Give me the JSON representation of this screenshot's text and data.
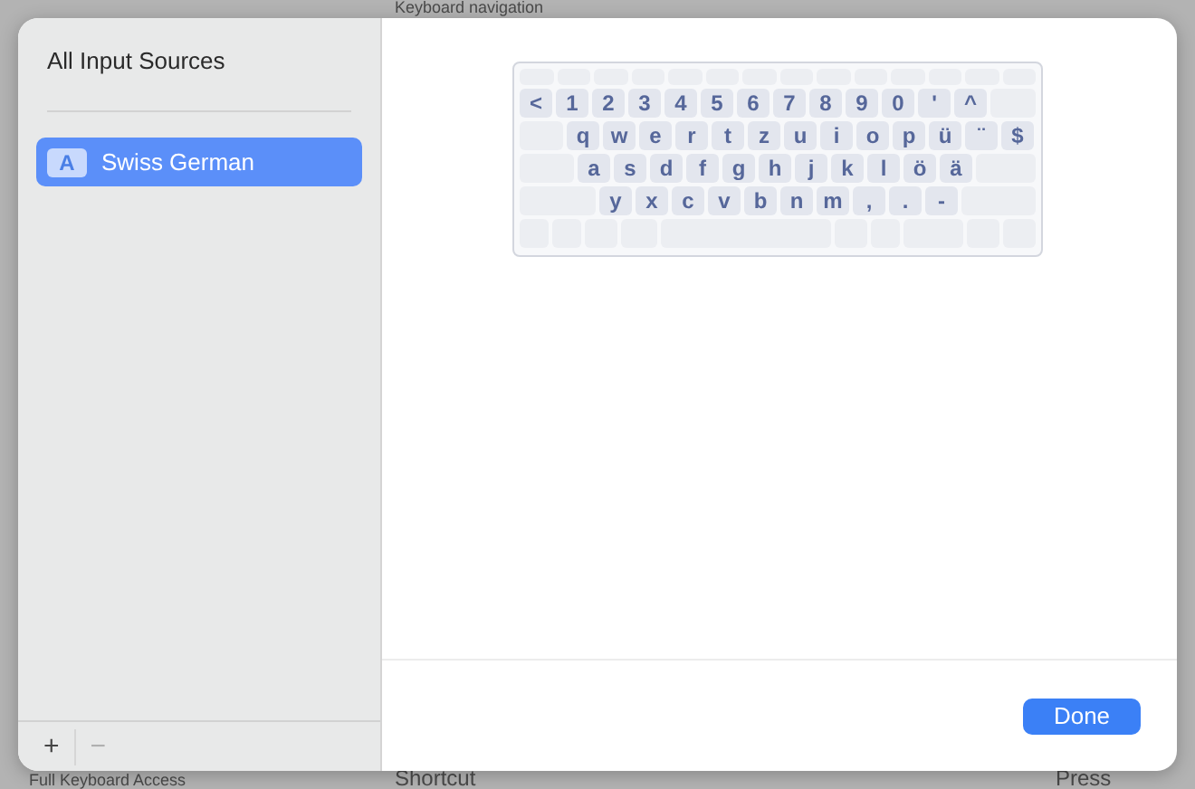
{
  "background": {
    "section_heading": "Keyboard navigation",
    "footer_left": "Full Keyboard Access",
    "row_label": "Shortcut",
    "row_value": "Press"
  },
  "sidebar": {
    "title": "All Input Sources",
    "items": [
      {
        "badge": "A",
        "label": "Swiss German",
        "selected": true
      }
    ],
    "actions": [
      {
        "label": "+",
        "disabled": false
      },
      {
        "label": "−",
        "disabled": true
      }
    ]
  },
  "keyboard": {
    "rows": [
      [
        "<",
        "1",
        "2",
        "3",
        "4",
        "5",
        "6",
        "7",
        "8",
        "9",
        "0",
        "'",
        "^"
      ],
      [
        "q",
        "w",
        "e",
        "r",
        "t",
        "z",
        "u",
        "i",
        "o",
        "p",
        "ü",
        "¨",
        "$"
      ],
      [
        "a",
        "s",
        "d",
        "f",
        "g",
        "h",
        "j",
        "k",
        "l",
        "ö",
        "ä"
      ],
      [
        "y",
        "x",
        "c",
        "v",
        "b",
        "n",
        "m",
        ",",
        ".",
        "-"
      ]
    ]
  },
  "buttons": [
    {
      "label": "Done"
    }
  ]
}
